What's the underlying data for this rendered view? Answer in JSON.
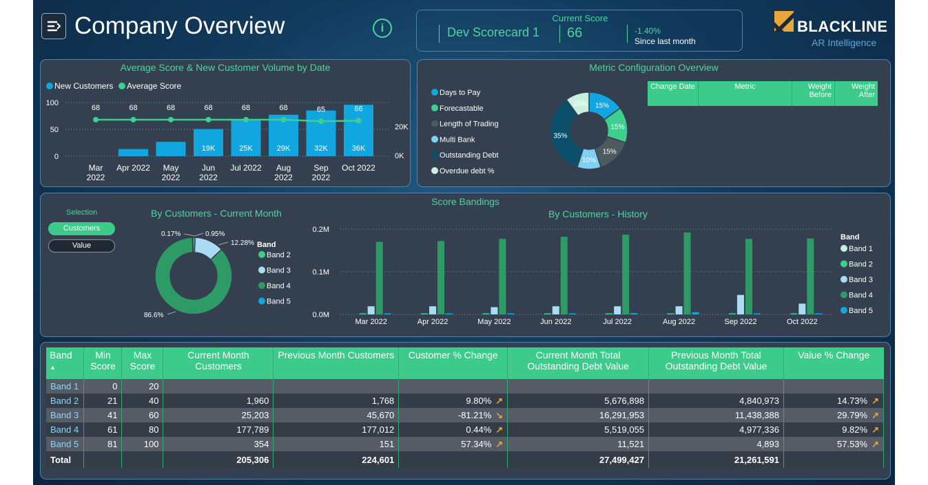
{
  "header": {
    "title": "Company Overview",
    "info_icon": "i",
    "current_score_label": "Current Score",
    "scorecard": "Dev Scorecard 1",
    "score": "66",
    "change": "-1.40%",
    "change_note": "Since last month",
    "logo": "BLACKLINE",
    "logo_sub": "AR Intelligence"
  },
  "chart_data": [
    {
      "type": "bar",
      "title": "Average Score & New Customer Volume by Date",
      "categories": [
        "Mar 2022",
        "Apr 2022",
        "May 2022",
        "Jun 2022",
        "Jul 2022",
        "Aug 2022",
        "Sep 2022",
        "Oct 2022"
      ],
      "series": [
        {
          "name": "New Customers",
          "type": "bar",
          "values": [
            0,
            5000,
            10000,
            19000,
            25000,
            29000,
            32000,
            36000
          ],
          "labels": [
            "",
            "",
            "",
            "19K",
            "25K",
            "29K",
            "32K",
            "36K"
          ],
          "color": "#11a6df"
        },
        {
          "name": "Average Score",
          "type": "line",
          "values": [
            68,
            68,
            68,
            68,
            68,
            68,
            65,
            66
          ],
          "color": "#3ecf8e"
        }
      ],
      "y_left_ticks": [
        "100",
        "50",
        "0"
      ],
      "y_right_ticks": [
        "20K",
        "0K"
      ],
      "ylim_left": [
        0,
        100
      ],
      "ylim_right": [
        0,
        40000
      ]
    },
    {
      "type": "pie",
      "title": "Metric Configuration Overview",
      "legend": [
        "Days to Pay",
        "Forecastable",
        "Length of Trading",
        "Multi Bank",
        "Outstanding Debt",
        "Overdue debt %"
      ],
      "colors": [
        "#11a6df",
        "#3ecf8e",
        "#4a5a5f",
        "#7fd0f2",
        "#0b4f6b",
        "#c8f0df"
      ],
      "values": [
        15,
        15,
        15,
        10,
        35,
        10
      ],
      "labels": [
        "15%",
        "15%",
        "15%",
        "10%",
        "35%",
        "10%"
      ]
    },
    {
      "type": "pie",
      "title": "By Customers - Current Month",
      "legend_title": "Band",
      "legend": [
        "Band 2",
        "Band 3",
        "Band 4",
        "Band 5"
      ],
      "colors": [
        "#3ecf8e",
        "#a9dcf2",
        "#2e9a65",
        "#11a6df"
      ],
      "values": [
        0.95,
        12.28,
        86.6,
        0.17
      ],
      "labels": [
        "0.95%",
        "12.28%",
        "86.6%",
        "0.17%"
      ]
    },
    {
      "type": "bar",
      "title": "By Customers - History",
      "categories": [
        "Mar 2022",
        "Apr 2022",
        "May 2022",
        "Jun 2022",
        "Jul 2022",
        "Aug 2022",
        "Sep 2022",
        "Oct 2022"
      ],
      "y_ticks": [
        "0.2M",
        "0.1M",
        "0.0M"
      ],
      "ylim": [
        0,
        200000
      ],
      "legend_title": "Band",
      "series": [
        {
          "name": "Band 1",
          "color": "#c8f0df",
          "values": [
            0,
            0,
            0,
            0,
            0,
            0,
            0,
            0
          ]
        },
        {
          "name": "Band 2",
          "color": "#3ecf8e",
          "values": [
            1000,
            1200,
            1300,
            1500,
            1600,
            1700,
            1768,
            1960
          ]
        },
        {
          "name": "Band 3",
          "color": "#a9dcf2",
          "values": [
            19000,
            19000,
            17000,
            19000,
            19000,
            19000,
            45670,
            25203
          ]
        },
        {
          "name": "Band 4",
          "color": "#2e9a65",
          "values": [
            170000,
            172000,
            177000,
            182000,
            187000,
            192000,
            177012,
            177789
          ]
        },
        {
          "name": "Band 5",
          "color": "#11a6df",
          "values": [
            500,
            500,
            1000,
            2000,
            3000,
            5000,
            151,
            354
          ]
        }
      ]
    }
  ],
  "panels": {
    "p1_title": "Average Score & New Customer Volume by Date",
    "p1_legend": [
      "New Customers",
      "Average Score"
    ],
    "p2_title": "Metric Configuration Overview",
    "p2_table_headers": [
      "Change Date",
      "Metric",
      "Weight Before",
      "Weight After"
    ],
    "p3_title": "Score Bandings",
    "selection_label": "Selection",
    "sel_customers": "Customers",
    "sel_value": "Value",
    "p3_left_title": "By Customers - Current Month",
    "p3_right_title": "By Customers - History"
  },
  "table": {
    "headers": [
      "Band",
      "Min Score",
      "Max Score",
      "Current Month Customers",
      "Previous Month Customers",
      "Customer % Change",
      "Current Month Total Outstanding Debt Value",
      "Previous Month Total Outstanding Debt Value",
      "Value % Change"
    ],
    "sort_icon": "▲",
    "rows": [
      [
        "Band 1",
        "0",
        "20",
        "",
        "",
        "",
        "",
        "",
        ""
      ],
      [
        "Band 2",
        "21",
        "40",
        "1,960",
        "1,768",
        "9.80%",
        "5,676,898",
        "4,840,973",
        "14.73%"
      ],
      [
        "Band 3",
        "41",
        "60",
        "25,203",
        "45,670",
        "-81.21%",
        "16,291,953",
        "11,438,388",
        "29.79%"
      ],
      [
        "Band 4",
        "61",
        "80",
        "177,789",
        "177,012",
        "0.44%",
        "5,519,055",
        "4,977,336",
        "9.82%"
      ],
      [
        "Band 5",
        "81",
        "100",
        "354",
        "151",
        "57.34%",
        "11,521",
        "4,893",
        "57.53%"
      ]
    ],
    "cust_arrows": [
      "",
      "↗",
      "↘",
      "↗",
      "↗"
    ],
    "val_arrows": [
      "",
      "↗",
      "↗",
      "↗",
      "↗"
    ],
    "total": [
      "Total",
      "",
      "",
      "205,306",
      "224,601",
      "",
      "27,499,427",
      "21,261,591",
      ""
    ]
  }
}
